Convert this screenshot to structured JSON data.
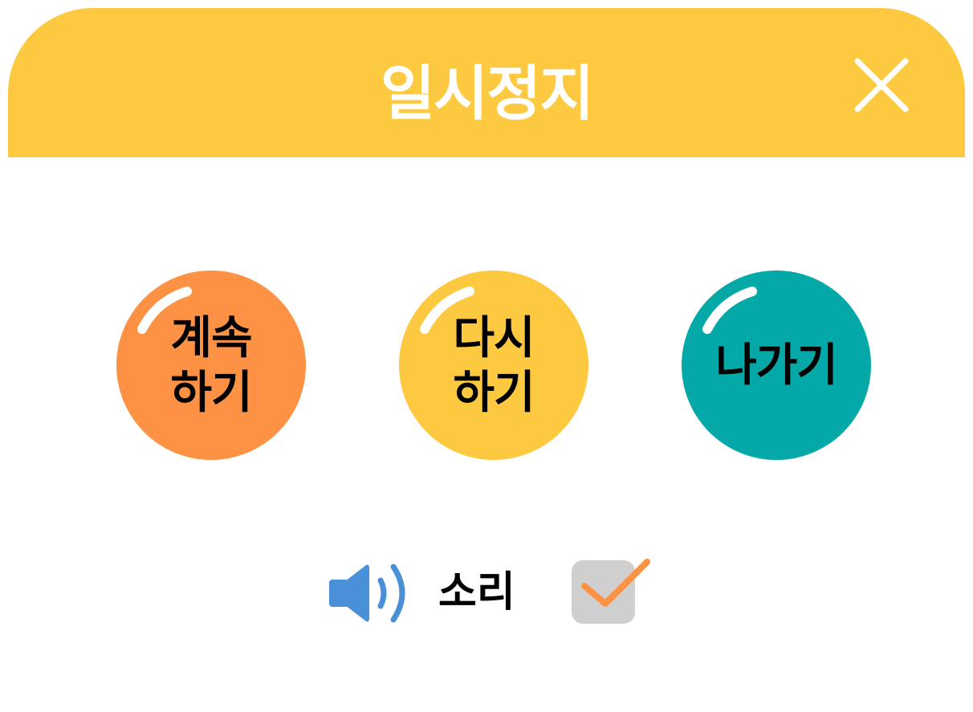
{
  "dialog": {
    "title": "일시정지",
    "header_color": "#FDC940",
    "close_icon": "close-icon"
  },
  "buttons": [
    {
      "line1": "계속",
      "line2": "하기",
      "color": "#FD9245"
    },
    {
      "line1": "다시",
      "line2": "하기",
      "color": "#FDC940"
    },
    {
      "line1": "나가기",
      "color": "#04A8A6"
    }
  ],
  "sound": {
    "icon": "speaker-icon",
    "label": "소리",
    "checked": true,
    "check_color": "#FD9245",
    "checkbox_color": "#CFCFCF"
  }
}
